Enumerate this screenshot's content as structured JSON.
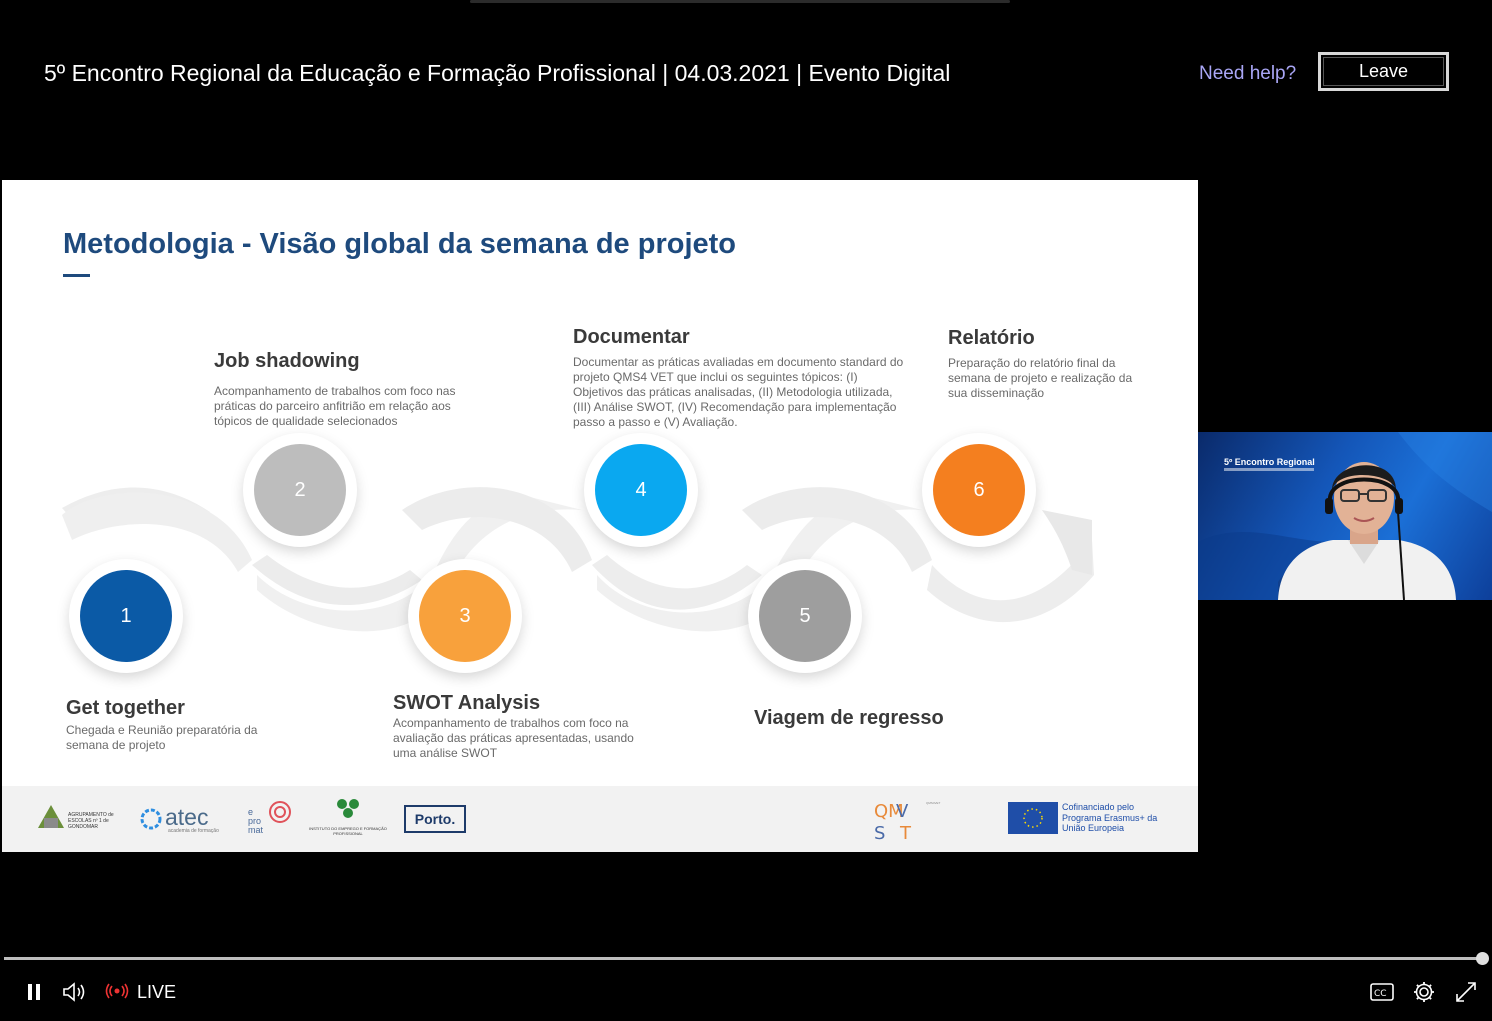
{
  "header": {
    "event_title": "5º Encontro Regional da Educação e Formação Profissional | 04.03.2021 | Evento Digital",
    "help_label": "Need help?",
    "leave_label": "Leave"
  },
  "slide": {
    "title": "Metodologia - Visão global da semana de projeto",
    "steps": [
      {
        "number": "1",
        "color": "#0b5aa6",
        "heading": "Get together",
        "description": "Chegada e Reunião preparatória da semana de projeto"
      },
      {
        "number": "2",
        "color": "#bdbdbd",
        "heading": "Job shadowing",
        "description": "Acompanhamento de trabalhos com foco nas práticas do parceiro anfitrião em relação aos tópicos de qualidade selecionados"
      },
      {
        "number": "3",
        "color": "#f8a13c",
        "heading": "SWOT Analysis",
        "description": "Acompanhamento de trabalhos com foco na avaliação das práticas apresentadas, usando uma análise SWOT"
      },
      {
        "number": "4",
        "color": "#0aa8f0",
        "heading": "Documentar",
        "description": "Documentar as práticas avaliadas em documento standard do projeto QMS4 VET que inclui os seguintes tópicos: (I) Objetivos das práticas analisadas, (II) Metodologia utilizada, (III) Análise SWOT, (IV) Recomendação para implementação passo a passo e (V) Avaliação."
      },
      {
        "number": "5",
        "color": "#9e9e9e",
        "heading": "Viagem de regresso",
        "description": ""
      },
      {
        "number": "6",
        "color": "#f47f1f",
        "heading": "Relatório",
        "description": "Preparação do relatório final da semana de projeto e realização da sua disseminação"
      }
    ],
    "logos": {
      "agrupamento": "AGRUPAMENTO de ESCOLAS nº 1 de GONDOMAR",
      "atec": "atec",
      "atec_sub": "academia de formação",
      "promat": "e pro mat",
      "iefp": "INSTITUTO DO EMPREGO E FORMAÇÃO PROFISSIONAL",
      "porto": "Porto.",
      "qms": "QMS4VET",
      "eu": "Cofinanciado pelo Programa Erasmus+ da União Europeia"
    }
  },
  "webcam": {
    "caption": "5º Encontro Regional"
  },
  "player": {
    "live_label": "LIVE",
    "progress": 0.999,
    "icons": [
      "pause-icon",
      "volume-icon",
      "live-indicator-icon",
      "captions-icon",
      "settings-icon",
      "fullscreen-icon"
    ]
  }
}
